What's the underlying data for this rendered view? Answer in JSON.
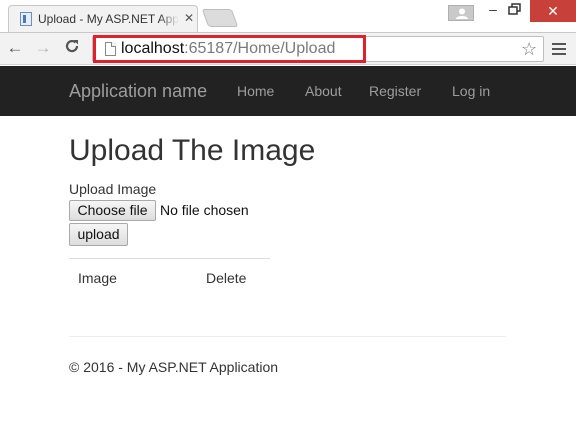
{
  "browser": {
    "tab_title": "Upload - My ASP.NET App",
    "tab_close_icon": "close-icon",
    "url_host": "localhost",
    "url_path": ":65187/Home/Upload",
    "window_controls": {
      "minimize": "–",
      "close": "✕"
    },
    "toolbar": {
      "back": "←",
      "forward": "→",
      "reload": "C",
      "star": "☆"
    },
    "highlight_color": "#e0202a"
  },
  "navbar": {
    "brand": "Application name",
    "links": [
      "Home",
      "About",
      "Register",
      "Log in"
    ],
    "background": "#222222"
  },
  "main": {
    "title": "Upload The Image",
    "upload_label": "Upload Image",
    "choose_file_label": "Choose file",
    "no_file_text": "No file chosen",
    "upload_button_label": "upload",
    "table_headers": [
      "Image",
      "Delete"
    ]
  },
  "footer": {
    "text": "© 2016 - My ASP.NET Application"
  }
}
